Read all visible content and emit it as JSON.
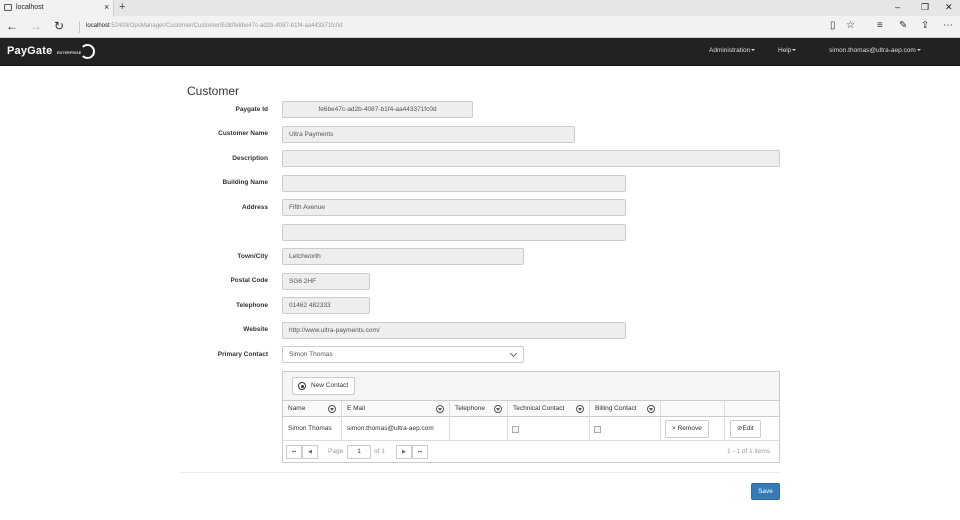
{
  "browser": {
    "tab_title": "localhost",
    "tab_close": "×",
    "new_tab": "+",
    "window_minimize": "–",
    "window_restore": "❐",
    "window_close": "✕",
    "url_host": "localhost",
    "url_path": ":52403/OpsManager/Customer/Customer/Edit/fe6be47c-ad2b-4087-b1f4-aa443371fc0d",
    "icons": [
      "back-icon",
      "forward-icon",
      "refresh-icon",
      "reading-view-icon",
      "favorite-star-icon",
      "hub-icon",
      "web-note-icon",
      "share-icon",
      "more-icon"
    ]
  },
  "navbar": {
    "brand": "PayGate",
    "brand_sub": "ENTERPRISE",
    "administration": "Administration",
    "help": "Help",
    "user": "simon.thomas@ultra-aep.com"
  },
  "form": {
    "title": "Customer",
    "labels": {
      "paygate_id": "Paygate Id",
      "customer_name": "Customer Name",
      "description": "Description",
      "building_name": "Building Name",
      "address": "Address",
      "town_city": "Town/City",
      "postal_code": "Postal Code",
      "telephone": "Telephone",
      "website": "Website",
      "primary_contact": "Primary Contact"
    },
    "values": {
      "paygate_id": "fe6be47c-ad2b-4087-b1f4-aa443371fc0d",
      "customer_name": "Ultra Payments",
      "description": "",
      "building_name": "",
      "address_line1": "Fifth Avenue",
      "address_line2": "",
      "town_city": "Letchworth",
      "postal_code": "SG6 2HF",
      "telephone": "01462 482333",
      "website": "http://www.ultra-payments.com/",
      "primary_contact": "Simon Thomas"
    }
  },
  "contacts_grid": {
    "new_contact_label": "New Contact",
    "columns": [
      "Name",
      "E Mail",
      "Telephone",
      "Technical Contact",
      "Billing Contact"
    ],
    "rows": [
      {
        "name": "Simon Thomas",
        "email": "simon.thomas@ultra-aep.com",
        "telephone": "",
        "technical_contact": false,
        "billing_contact": false
      }
    ],
    "remove_label": "Remove",
    "edit_label": "Edit",
    "pager": {
      "page_label": "Page",
      "page": "1",
      "of_label": "of 1",
      "info": "1 - 1 of 1 items"
    }
  },
  "save_label": "Save"
}
